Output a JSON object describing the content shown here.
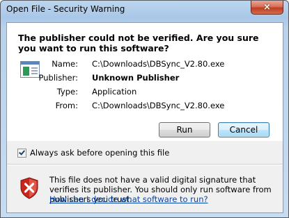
{
  "window": {
    "title": "Open File - Security Warning",
    "close_label": "×"
  },
  "heading": "The publisher could not be verified.  Are you sure you want to run this software?",
  "icons": {
    "app": "application-icon",
    "shield": "shield-error-icon",
    "close": "close-icon",
    "check": "checkmark-icon"
  },
  "details": [
    {
      "label": "Name:",
      "value": "C:\\Downloads\\DBSync_V2.80.exe",
      "bold": false
    },
    {
      "label": "Publisher:",
      "value": "Unknown Publisher",
      "bold": true
    },
    {
      "label": "Type:",
      "value": "Application",
      "bold": false
    },
    {
      "label": "From:",
      "value": "C:\\Downloads\\DBSync_V2.80.exe",
      "bold": false
    }
  ],
  "buttons": {
    "run_label": "Run",
    "cancel_label": "Cancel"
  },
  "checkbox": {
    "label": "Always ask before opening this file",
    "checked": true
  },
  "warning": {
    "text": "This file does not have a valid digital signature that verifies its publisher.  You should only run software from publishers you trust.",
    "link": "How can I decide what software to run?"
  },
  "colors": {
    "link": "#0645ad",
    "close_button": "#c23d22",
    "shield_red": "#c8261b",
    "default_button_border": "#3c7fb1"
  }
}
